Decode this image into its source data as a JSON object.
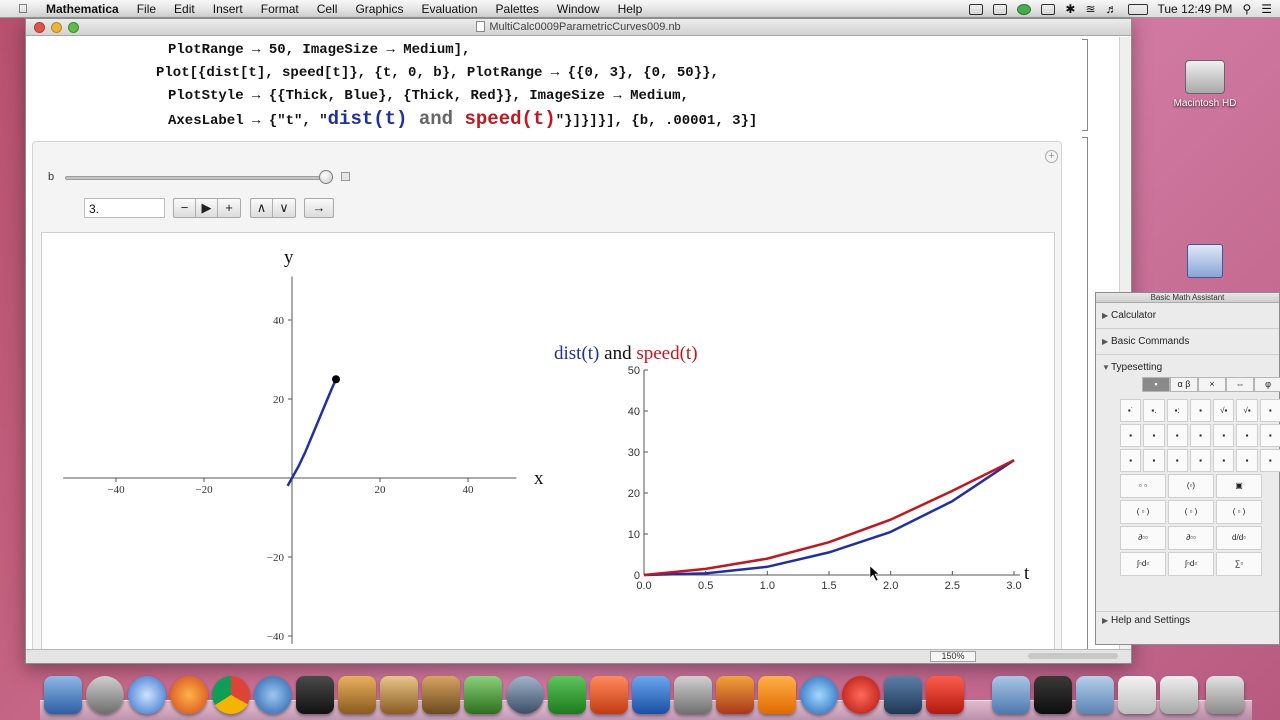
{
  "menubar": {
    "app": "Mathematica",
    "items": [
      "File",
      "Edit",
      "Insert",
      "Format",
      "Cell",
      "Graphics",
      "Evaluation",
      "Palettes",
      "Window",
      "Help"
    ],
    "clock": "Tue 12:49 PM"
  },
  "window": {
    "title": "MultiCalc0009ParametricCurves009.nb",
    "code_lines": [
      "PlotRange → 50, ImageSize → Medium],",
      "Plot[{dist[t], speed[t]}, {t, 0, b}, PlotRange → {{0, 3}, {0, 50}},",
      "PlotStyle → {{Thick, Blue}, {Thick, Red}}, ImageSize → Medium,"
    ],
    "code_line4_prefix": "AxesLabel → {\"t\", \"",
    "code_line4_blue": "dist(t)",
    "code_line4_and": " and ",
    "code_line4_red": "speed(t)",
    "code_line4_suffix": "\"}]}]}], {b, .00001, 3}]",
    "zoom": "150%"
  },
  "manipulate": {
    "var_label": "b",
    "value": "3.",
    "slider_fraction": 1.0,
    "buttons": [
      "−",
      "▶",
      "+",
      "∧",
      "∨",
      "→"
    ]
  },
  "chart_data": [
    {
      "type": "line",
      "title": "",
      "xlabel": "x",
      "ylabel": "y",
      "xlim": [
        -52,
        52
      ],
      "ylim": [
        -42,
        50
      ],
      "x_ticks": [
        -40,
        -20,
        20,
        40
      ],
      "y_ticks": [
        40,
        20,
        -20,
        -40
      ],
      "series": [
        {
          "color": "#1f2fa8",
          "x": [
            -1,
            0,
            1.5,
            3,
            4.5,
            6,
            7.5,
            9,
            10
          ],
          "y": [
            -2,
            0,
            3,
            6.5,
            10.5,
            14.5,
            18.5,
            22.5,
            25
          ]
        }
      ],
      "endpoint": [
        10,
        25
      ]
    },
    {
      "type": "line",
      "title_parts": [
        {
          "text": "dist(t)",
          "color": "#1f2fa8"
        },
        {
          "text": " and ",
          "color": "#111111"
        },
        {
          "text": "speed(t)",
          "color": "#c8141c"
        }
      ],
      "xlabel": "t",
      "xlim": [
        0,
        3
      ],
      "ylim": [
        0,
        50
      ],
      "x_ticks": [
        "0.0",
        "0.5",
        "1.0",
        "1.5",
        "2.0",
        "2.5",
        "3.0"
      ],
      "y_ticks": [
        "0",
        "10",
        "20",
        "30",
        "40",
        "50"
      ],
      "series": [
        {
          "color": "#1f2fa8",
          "x": [
            0,
            0.5,
            1,
            1.5,
            2,
            2.5,
            3
          ],
          "y": [
            0,
            0.4,
            2,
            5.5,
            10.5,
            18,
            28
          ]
        },
        {
          "color": "#c8141c",
          "x": [
            0,
            0.5,
            1,
            1.5,
            2,
            2.5,
            3
          ],
          "y": [
            0,
            1.5,
            4,
            8,
            13.5,
            20.5,
            28
          ]
        }
      ]
    }
  ],
  "desktop": {
    "hd_label": "Macintosh HD",
    "app_label": ""
  },
  "palette": {
    "title": "Basic Math Assistant",
    "sections": [
      "Calculator",
      "Basic Commands",
      "Typesetting"
    ],
    "help": "Help and Settings",
    "tabs": [
      "▪",
      "α β",
      "×",
      "⇔",
      "φ"
    ]
  }
}
